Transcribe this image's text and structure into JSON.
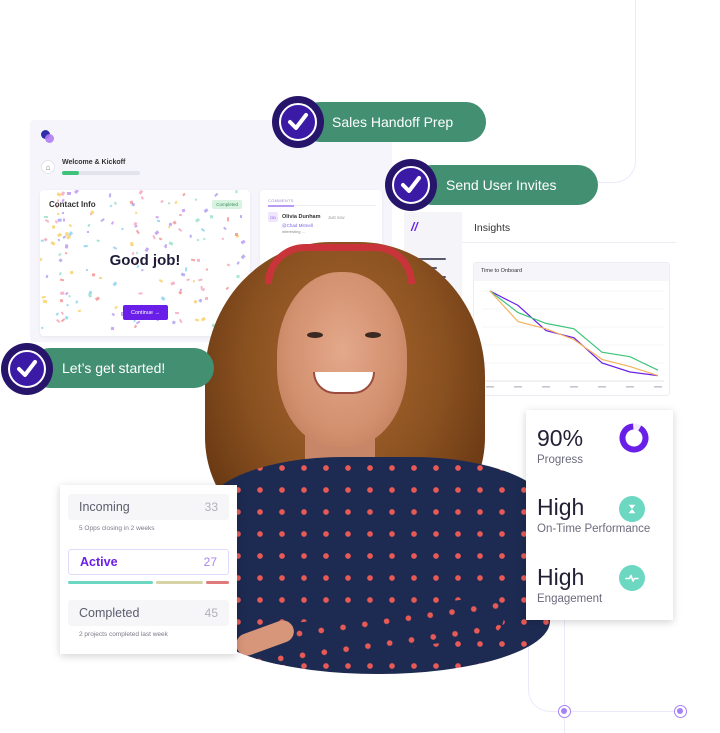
{
  "pills": {
    "sales_handoff": "Sales Handoff Prep",
    "send_invites": "Send User Invites",
    "get_started": "Let’s get started!"
  },
  "app_panel": {
    "stage_title": "Welcome & Kickoff",
    "stage_progress": 0.22,
    "contact_card": {
      "title": "Contact Info",
      "badge": "Completed",
      "message": "Good job!",
      "continue_label": "Continue →"
    },
    "comments": {
      "label": "COMMENTS",
      "avatar_initials": "OD",
      "author": "Olivia Dunham",
      "time": "Just now",
      "mention": "@Chad Mitmell",
      "text": "interesting ..."
    }
  },
  "insights": {
    "title": "Insights",
    "nav_active_label": "Insights",
    "chart_title": "Time to Onboard"
  },
  "chart_data": {
    "type": "line",
    "title": "Time to Onboard",
    "xlabel": "",
    "ylabel": "",
    "x": [
      1,
      2,
      3,
      4,
      5,
      6,
      7
    ],
    "ylim": [
      0,
      5
    ],
    "grid": true,
    "series": [
      {
        "name": "purple",
        "color": "#6a1fe8",
        "values": [
          5.0,
          4.2,
          2.8,
          2.4,
          1.0,
          0.5,
          0.3
        ]
      },
      {
        "name": "green",
        "color": "#3ec47a",
        "values": [
          5.0,
          3.8,
          3.2,
          2.9,
          1.6,
          1.35,
          0.6
        ]
      },
      {
        "name": "orange",
        "color": "#f5b25c",
        "values": [
          5.0,
          3.3,
          2.9,
          2.3,
          1.2,
          0.8,
          0.3
        ]
      }
    ]
  },
  "metrics": [
    {
      "value": "90%",
      "label": "Progress",
      "icon": "donut-progress-icon",
      "percent": 90
    },
    {
      "value": "High",
      "label": "On-Time Performance",
      "icon": "hourglass-icon"
    },
    {
      "value": "High",
      "label": "Engagement",
      "icon": "pulse-icon"
    }
  ],
  "pipeline": {
    "rows": [
      {
        "name": "Incoming",
        "count": "33",
        "sub": "5 Opps closing in 2 weeks"
      },
      {
        "name": "Active",
        "count": "27"
      },
      {
        "name": "Completed",
        "count": "45",
        "sub": "2 projects completed last week"
      }
    ],
    "segments": [
      {
        "color": "#6cd8c2",
        "share": 0.55
      },
      {
        "color": "#d8d3a5",
        "share": 0.3
      },
      {
        "color": "#e07a7a",
        "share": 0.15
      }
    ]
  },
  "colors": {
    "pill_green": "#428f72",
    "check_navy": "#27156b",
    "brand_purple": "#6a1fe8",
    "teal": "#6cd8c2"
  }
}
